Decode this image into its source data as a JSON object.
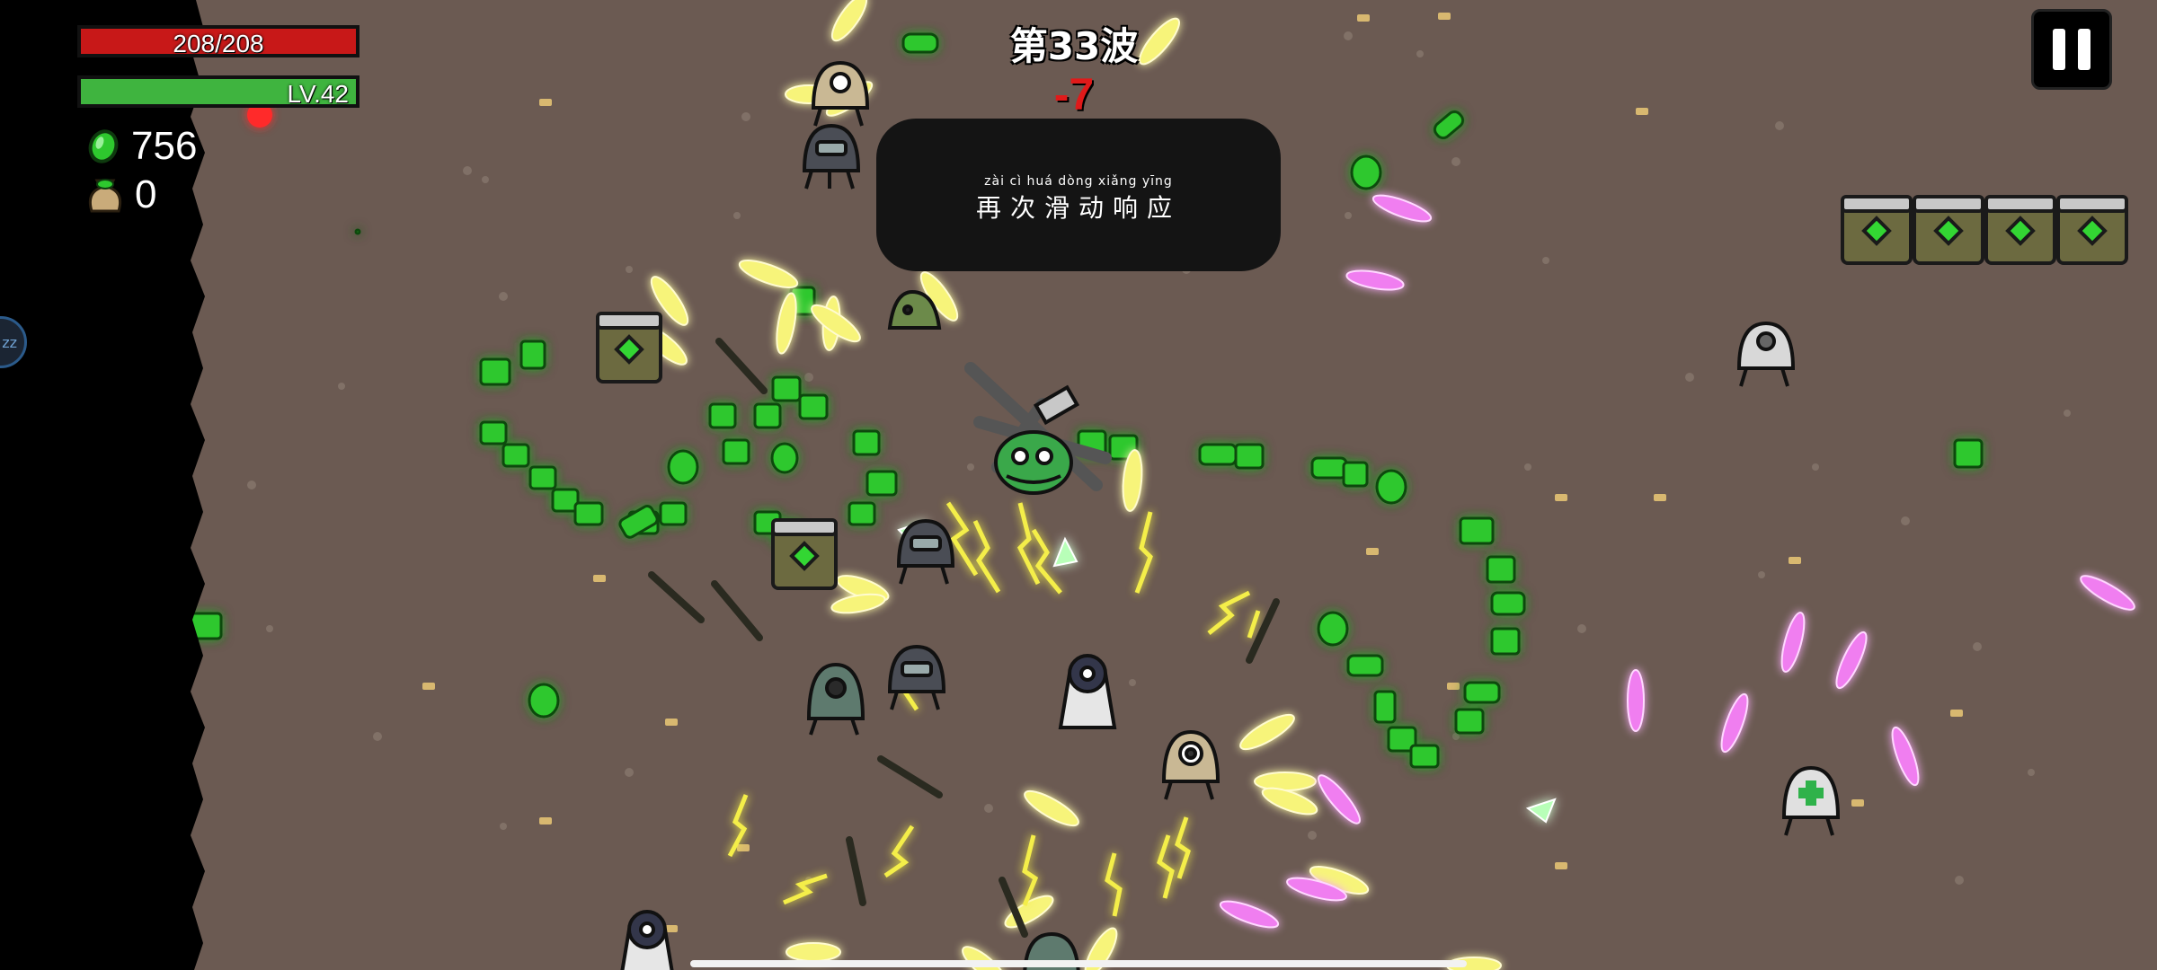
{
  "hud": {
    "hp_text": "208/208",
    "hp_fraction": 1.0,
    "level_text": "LV.42",
    "xp_fraction": 1.0,
    "materials_count": "756",
    "bag_count": "0"
  },
  "wave": {
    "title": "第33波",
    "timer": "-7"
  },
  "hint": {
    "pinyin": "zài cì huá dòng xiǎng yīng",
    "text": "再次滑动响应"
  },
  "colors": {
    "ground": "#6b5a52",
    "hp": "#c81818",
    "xp": "#3fb43f",
    "material": "#2ec82e",
    "yellow_projectile": "#f5f07a",
    "pink_projectile": "#e86ae8",
    "timer": "#e01a1a"
  },
  "icons": {
    "pause": "pause-icon",
    "material": "material-icon",
    "bag": "bag-icon",
    "crate": "crate-icon"
  }
}
